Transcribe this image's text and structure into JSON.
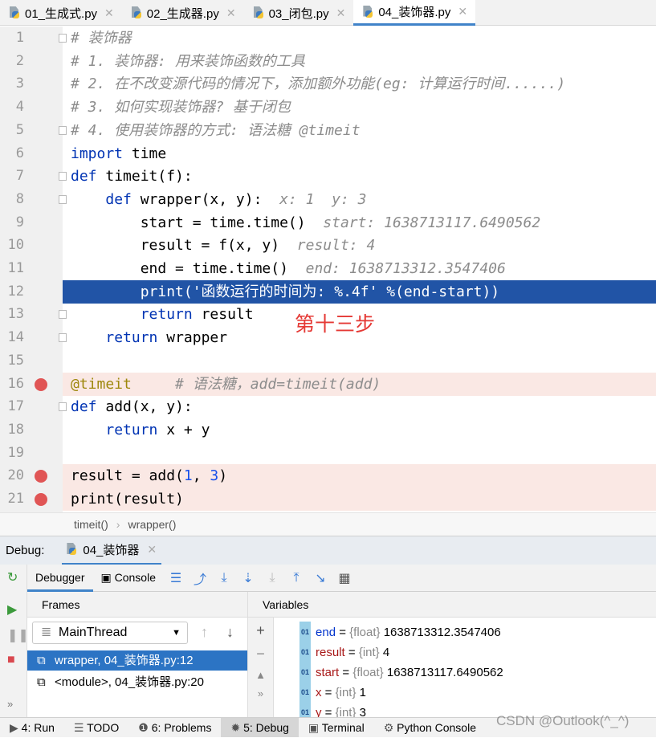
{
  "tabs": [
    {
      "label": "01_生成式.py"
    },
    {
      "label": "02_生成器.py"
    },
    {
      "label": "03_闭包.py"
    },
    {
      "label": "04_装饰器.py",
      "active": true
    }
  ],
  "editor": {
    "current_line": 12,
    "breakpoint_lines": [
      16,
      20,
      21
    ],
    "fold_lines": [
      1,
      5,
      7,
      8,
      13,
      14,
      17
    ],
    "lines": [
      [
        [
          "cm",
          "# 装饰器"
        ]
      ],
      [
        [
          "cm",
          "# 1. 装饰器: 用来装饰函数的工具"
        ]
      ],
      [
        [
          "cm",
          "# 2. 在不改变源代码的情况下，添加额外功能(eg: 计算运行时间......)"
        ]
      ],
      [
        [
          "cm",
          "# 3. 如何实现装饰器? 基于闭包"
        ]
      ],
      [
        [
          "cm",
          "# 4. 使用装饰器的方式: 语法糖 @timeit"
        ]
      ],
      [
        [
          "kw",
          "import"
        ],
        [
          "df",
          " time"
        ]
      ],
      [
        [
          "kw",
          "def"
        ],
        [
          "df",
          " timeit(f):"
        ]
      ],
      [
        [
          "df",
          "    "
        ],
        [
          "kw",
          "def"
        ],
        [
          "df",
          " wrapper(x, y):  "
        ],
        [
          "inl",
          "x: 1  y: 3"
        ]
      ],
      [
        [
          "df",
          "        start = time.time()  "
        ],
        [
          "inl",
          "start: 1638713117.6490562"
        ]
      ],
      [
        [
          "df",
          "        result = f(x, y)  "
        ],
        [
          "inl",
          "result: 4"
        ]
      ],
      [
        [
          "df",
          "        end = time.time()  "
        ],
        [
          "inl",
          "end: 1638713312.3547406"
        ]
      ],
      [
        [
          "df",
          "        print("
        ],
        [
          "str",
          "'函数运行的时间为: %.4f'"
        ],
        [
          "df",
          " %(end-start))"
        ]
      ],
      [
        [
          "df",
          "        "
        ],
        [
          "kw",
          "return"
        ],
        [
          "df",
          " result"
        ]
      ],
      [
        [
          "df",
          "    "
        ],
        [
          "kw",
          "return"
        ],
        [
          "df",
          " wrapper"
        ]
      ],
      [],
      [
        [
          "dec",
          "@timeit"
        ],
        [
          "df",
          "     "
        ],
        [
          "cm",
          "# 语法糖，add=timeit(add)"
        ]
      ],
      [
        [
          "kw",
          "def"
        ],
        [
          "df",
          " add(x, y):"
        ]
      ],
      [
        [
          "df",
          "    "
        ],
        [
          "kw",
          "return"
        ],
        [
          "df",
          " x + y"
        ]
      ],
      [],
      [
        [
          "df",
          "result = add("
        ],
        [
          "num",
          "1"
        ],
        [
          "df",
          ", "
        ],
        [
          "num",
          "3"
        ],
        [
          "df",
          ")"
        ]
      ],
      [
        [
          "df",
          "print(result)"
        ]
      ]
    ]
  },
  "annotation": "第十三步",
  "breadcrumb": [
    "timeit()",
    "wrapper()"
  ],
  "debug": {
    "label": "Debug:",
    "session": "04_装饰器",
    "tabs": {
      "debugger": "Debugger",
      "console": "Console"
    },
    "frames_title": "Frames",
    "variables_title": "Variables",
    "thread": "MainThread",
    "frames": [
      {
        "label": "wrapper, 04_装饰器.py:12",
        "selected": true
      },
      {
        "label": "<module>, 04_装饰器.py:20"
      }
    ],
    "variables": [
      {
        "name": "end",
        "type": "{float}",
        "value": "1638713312.3547406",
        "changed": true
      },
      {
        "name": "result",
        "type": "{int}",
        "value": "4"
      },
      {
        "name": "start",
        "type": "{float}",
        "value": "1638713117.6490562"
      },
      {
        "name": "x",
        "type": "{int}",
        "value": "1"
      },
      {
        "name": "y",
        "type": "{int}",
        "value": "3"
      }
    ]
  },
  "statusbar": [
    "4: Run",
    "TODO",
    "6: Problems",
    "5: Debug",
    "Terminal",
    "Python Console"
  ],
  "watermark": "CSDN @Outlook(^_^)"
}
